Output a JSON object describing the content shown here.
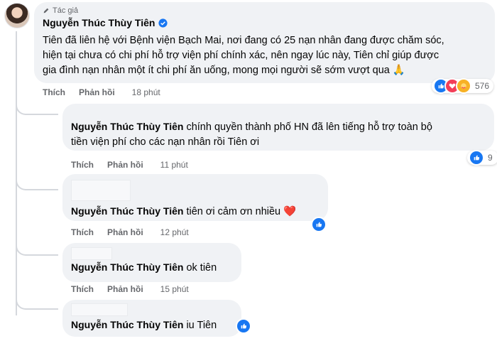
{
  "main_comment": {
    "author_badge": "Tác giả",
    "author": "Nguyễn Thúc Thùy Tiên",
    "lines": [
      "Tiên đã liên hệ với Bệnh viện Bạch Mai, nơi đang có 25 nạn nhân đang được chăm sóc,",
      "hiện tại chưa có chi phí hỗ trợ viện phí chính xác, nên ngay lúc này, Tiên chỉ giúp được",
      "gia đình nạn nhân một ít chi phí ăn uống, mong mọi người sẽ sớm vượt qua"
    ],
    "emoji": "🙏",
    "like_label": "Thích",
    "reply_label": "Phản hồi",
    "time": "18 phút",
    "reaction_count": "576"
  },
  "replies": [
    {
      "mention": "Nguyễn Thúc Thùy Tiên",
      "text_line1": " chính quyền thành phố HN đã lên tiếng hỗ trợ toàn bộ",
      "text_line2": "tiền viện phí cho các nạn nhân rồi Tiên ơi",
      "like_label": "Thích",
      "reply_label": "Phản hồi",
      "time": "11 phút",
      "reaction_count": "9"
    },
    {
      "mention": "Nguyễn Thúc Thùy Tiên",
      "text": " tiên ơi cảm ơn nhiều ",
      "emoji": "❤️",
      "like_label": "Thích",
      "reply_label": "Phản hồi",
      "time": "12 phút"
    },
    {
      "mention": "Nguyễn Thúc Thùy Tiên",
      "text": " ok tiên",
      "like_label": "Thích",
      "reply_label": "Phản hồi",
      "time": "15 phút"
    },
    {
      "mention": "Nguyễn Thúc Thùy Tiên",
      "text": " iu Tiên"
    }
  ],
  "colors": {
    "bubble": "#f0f2f5",
    "like_blue": "#1877f2",
    "heart_red": "#f33e58",
    "meta_gray": "#65676b"
  }
}
